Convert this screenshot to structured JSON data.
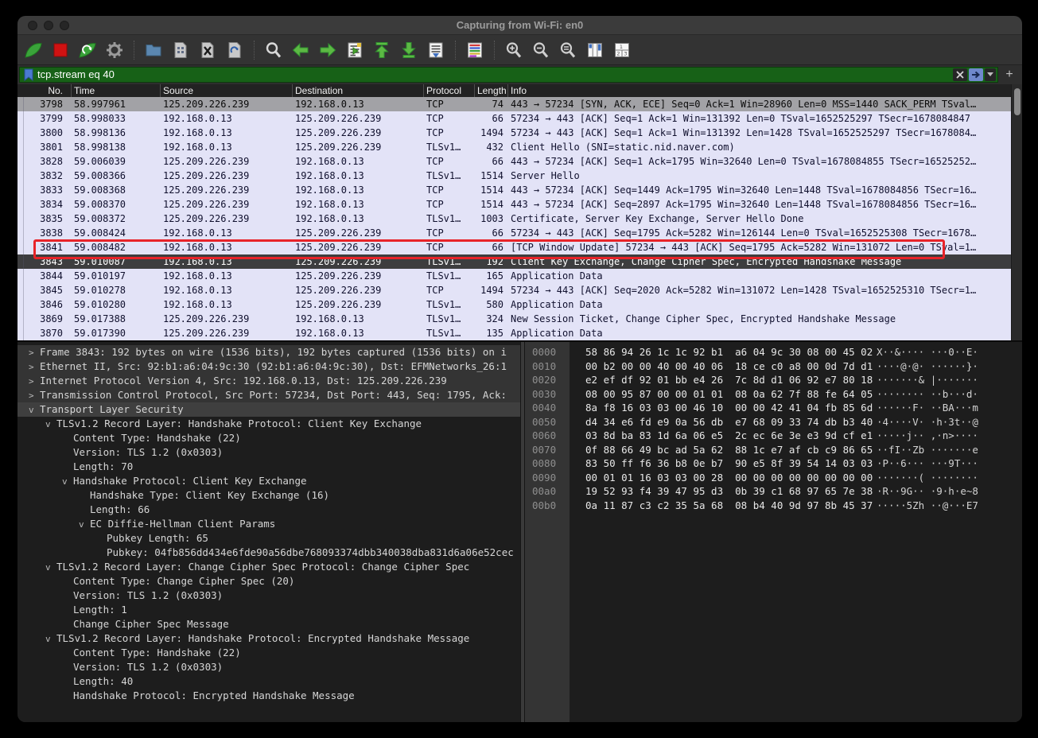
{
  "window": {
    "title": "Capturing from Wi-Fi: en0"
  },
  "colors": {
    "filter_bar_green": "#176117",
    "annotation_red": "#e82329",
    "row_lavender": "#e3e3f7",
    "selected_row": "#3d3d3f",
    "gray_row": "#a2a2a6"
  },
  "toolbar": {
    "items": [
      {
        "name": "start-capture",
        "icon": "wireshark-fin"
      },
      {
        "name": "stop-capture",
        "icon": "stop"
      },
      {
        "name": "restart-capture",
        "icon": "restart-fin"
      },
      {
        "name": "capture-options",
        "icon": "gear"
      },
      {
        "sep": true
      },
      {
        "name": "open-file",
        "icon": "folder"
      },
      {
        "name": "save-file",
        "icon": "save-doc"
      },
      {
        "name": "close-file",
        "icon": "close-doc"
      },
      {
        "name": "reload-file",
        "icon": "reload-doc"
      },
      {
        "sep": true
      },
      {
        "name": "find-packet",
        "icon": "magnifier"
      },
      {
        "name": "go-back",
        "icon": "arrow-left"
      },
      {
        "name": "go-forward",
        "icon": "arrow-right"
      },
      {
        "name": "go-to-packet",
        "icon": "goto-doc"
      },
      {
        "name": "go-first-packet",
        "icon": "arrow-top"
      },
      {
        "name": "go-last-packet",
        "icon": "arrow-bottom"
      },
      {
        "name": "auto-scroll",
        "icon": "autoscroll-doc"
      },
      {
        "sep": true
      },
      {
        "name": "colorize-packets",
        "icon": "colorize"
      },
      {
        "sep": true
      },
      {
        "name": "zoom-in",
        "icon": "magnifier-plus"
      },
      {
        "name": "zoom-out",
        "icon": "magnifier-minus"
      },
      {
        "name": "zoom-reset",
        "icon": "magnifier-equal"
      },
      {
        "name": "resize-columns",
        "icon": "columns"
      },
      {
        "name": "layout-chooser",
        "icon": "layout-123"
      }
    ]
  },
  "filter": {
    "value": "tcp.stream eq 40",
    "add_button_label": "+"
  },
  "packet_list": {
    "columns": [
      {
        "id": "no",
        "label": "No."
      },
      {
        "id": "time",
        "label": "Time"
      },
      {
        "id": "source",
        "label": "Source"
      },
      {
        "id": "destination",
        "label": "Destination"
      },
      {
        "id": "protocol",
        "label": "Protocol"
      },
      {
        "id": "length",
        "label": "Length"
      },
      {
        "id": "info",
        "label": "Info"
      }
    ],
    "rows": [
      {
        "no": "3798",
        "time": "58.997961",
        "source": "125.209.226.239",
        "destination": "192.168.0.13",
        "protocol": "TCP",
        "length": "74",
        "info": "443 → 57234 [SYN, ACK, ECE] Seq=0 Ack=1 Win=28960 Len=0 MSS=1440 SACK_PERM TSval…",
        "state": "gray"
      },
      {
        "no": "3799",
        "time": "58.998033",
        "source": "192.168.0.13",
        "destination": "125.209.226.239",
        "protocol": "TCP",
        "length": "66",
        "info": "57234 → 443 [ACK] Seq=1 Ack=1 Win=131392 Len=0 TSval=1652525297 TSecr=1678084847",
        "state": ""
      },
      {
        "no": "3800",
        "time": "58.998136",
        "source": "192.168.0.13",
        "destination": "125.209.226.239",
        "protocol": "TCP",
        "length": "1494",
        "info": "57234 → 443 [ACK] Seq=1 Ack=1 Win=131392 Len=1428 TSval=1652525297 TSecr=1678084…",
        "state": ""
      },
      {
        "no": "3801",
        "time": "58.998138",
        "source": "192.168.0.13",
        "destination": "125.209.226.239",
        "protocol": "TLSv1…",
        "length": "432",
        "info": "Client Hello (SNI=static.nid.naver.com)",
        "state": ""
      },
      {
        "no": "3828",
        "time": "59.006039",
        "source": "125.209.226.239",
        "destination": "192.168.0.13",
        "protocol": "TCP",
        "length": "66",
        "info": "443 → 57234 [ACK] Seq=1 Ack=1795 Win=32640 Len=0 TSval=1678084855 TSecr=16525252…",
        "state": ""
      },
      {
        "no": "3832",
        "time": "59.008366",
        "source": "125.209.226.239",
        "destination": "192.168.0.13",
        "protocol": "TLSv1…",
        "length": "1514",
        "info": "Server Hello",
        "state": ""
      },
      {
        "no": "3833",
        "time": "59.008368",
        "source": "125.209.226.239",
        "destination": "192.168.0.13",
        "protocol": "TCP",
        "length": "1514",
        "info": "443 → 57234 [ACK] Seq=1449 Ack=1795 Win=32640 Len=1448 TSval=1678084856 TSecr=16…",
        "state": ""
      },
      {
        "no": "3834",
        "time": "59.008370",
        "source": "125.209.226.239",
        "destination": "192.168.0.13",
        "protocol": "TCP",
        "length": "1514",
        "info": "443 → 57234 [ACK] Seq=2897 Ack=1795 Win=32640 Len=1448 TSval=1678084856 TSecr=16…",
        "state": ""
      },
      {
        "no": "3835",
        "time": "59.008372",
        "source": "125.209.226.239",
        "destination": "192.168.0.13",
        "protocol": "TLSv1…",
        "length": "1003",
        "info": "Certificate, Server Key Exchange, Server Hello Done",
        "state": ""
      },
      {
        "no": "3838",
        "time": "59.008424",
        "source": "192.168.0.13",
        "destination": "125.209.226.239",
        "protocol": "TCP",
        "length": "66",
        "info": "57234 → 443 [ACK] Seq=1795 Ack=5282 Win=126144 Len=0 TSval=1652525308 TSecr=1678…",
        "state": ""
      },
      {
        "no": "3841",
        "time": "59.008482",
        "source": "192.168.0.13",
        "destination": "125.209.226.239",
        "protocol": "TCP",
        "length": "66",
        "info": "[TCP Window Update] 57234 → 443 [ACK] Seq=1795 Ack=5282 Win=131072 Len=0 TSval=1…",
        "state": ""
      },
      {
        "no": "3843",
        "time": "59.010087",
        "source": "192.168.0.13",
        "destination": "125.209.226.239",
        "protocol": "TLSv1…",
        "length": "192",
        "info": "Client Key Exchange, Change Cipher Spec, Encrypted Handshake Message",
        "state": "selected"
      },
      {
        "no": "3844",
        "time": "59.010197",
        "source": "192.168.0.13",
        "destination": "125.209.226.239",
        "protocol": "TLSv1…",
        "length": "165",
        "info": "Application Data",
        "state": ""
      },
      {
        "no": "3845",
        "time": "59.010278",
        "source": "192.168.0.13",
        "destination": "125.209.226.239",
        "protocol": "TCP",
        "length": "1494",
        "info": "57234 → 443 [ACK] Seq=2020 Ack=5282 Win=131072 Len=1428 TSval=1652525310 TSecr=1…",
        "state": ""
      },
      {
        "no": "3846",
        "time": "59.010280",
        "source": "192.168.0.13",
        "destination": "125.209.226.239",
        "protocol": "TLSv1…",
        "length": "580",
        "info": "Application Data",
        "state": ""
      },
      {
        "no": "3869",
        "time": "59.017388",
        "source": "125.209.226.239",
        "destination": "192.168.0.13",
        "protocol": "TLSv1…",
        "length": "324",
        "info": "New Session Ticket, Change Cipher Spec, Encrypted Handshake Message",
        "state": ""
      },
      {
        "no": "3870",
        "time": "59.017390",
        "source": "125.209.226.239",
        "destination": "192.168.0.13",
        "protocol": "TLSv1…",
        "length": "135",
        "info": "Application Data",
        "state": ""
      }
    ]
  },
  "details": {
    "lines": [
      {
        "level": 0,
        "arrow": ">",
        "text": "Frame 3843: 192 bytes on wire (1536 bits), 192 bytes captured (1536 bits) on i",
        "block": true
      },
      {
        "level": 0,
        "arrow": ">",
        "text": "Ethernet II, Src: 92:b1:a6:04:9c:30 (92:b1:a6:04:9c:30), Dst: EFMNetworks_26:1",
        "block": true
      },
      {
        "level": 0,
        "arrow": ">",
        "text": "Internet Protocol Version 4, Src: 192.168.0.13, Dst: 125.209.226.239",
        "block": true
      },
      {
        "level": 0,
        "arrow": ">",
        "text": "Transmission Control Protocol, Src Port: 57234, Dst Port: 443, Seq: 1795, Ack:",
        "block": true
      },
      {
        "level": 0,
        "arrow": "v",
        "text": "Transport Layer Security",
        "block": true,
        "selected": true
      },
      {
        "level": 1,
        "arrow": "v",
        "text": "TLSv1.2 Record Layer: Handshake Protocol: Client Key Exchange"
      },
      {
        "level": 2,
        "arrow": "",
        "text": "Content Type: Handshake (22)"
      },
      {
        "level": 2,
        "arrow": "",
        "text": "Version: TLS 1.2 (0x0303)"
      },
      {
        "level": 2,
        "arrow": "",
        "text": "Length: 70"
      },
      {
        "level": 2,
        "arrow": "v",
        "text": "Handshake Protocol: Client Key Exchange"
      },
      {
        "level": 3,
        "arrow": "",
        "text": "Handshake Type: Client Key Exchange (16)"
      },
      {
        "level": 3,
        "arrow": "",
        "text": "Length: 66"
      },
      {
        "level": 3,
        "arrow": "v",
        "text": "EC Diffie-Hellman Client Params"
      },
      {
        "level": 4,
        "arrow": "",
        "text": "Pubkey Length: 65"
      },
      {
        "level": 4,
        "arrow": "",
        "text": "Pubkey: 04fb856dd434e6fde90a56dbe768093374dbb340038dba831d6a06e52cec"
      },
      {
        "level": 1,
        "arrow": "v",
        "text": "TLSv1.2 Record Layer: Change Cipher Spec Protocol: Change Cipher Spec"
      },
      {
        "level": 2,
        "arrow": "",
        "text": "Content Type: Change Cipher Spec (20)"
      },
      {
        "level": 2,
        "arrow": "",
        "text": "Version: TLS 1.2 (0x0303)"
      },
      {
        "level": 2,
        "arrow": "",
        "text": "Length: 1"
      },
      {
        "level": 2,
        "arrow": "",
        "text": "Change Cipher Spec Message"
      },
      {
        "level": 1,
        "arrow": "v",
        "text": "TLSv1.2 Record Layer: Handshake Protocol: Encrypted Handshake Message"
      },
      {
        "level": 2,
        "arrow": "",
        "text": "Content Type: Handshake (22)"
      },
      {
        "level": 2,
        "arrow": "",
        "text": "Version: TLS 1.2 (0x0303)"
      },
      {
        "level": 2,
        "arrow": "",
        "text": "Length: 40"
      },
      {
        "level": 2,
        "arrow": "",
        "text": "Handshake Protocol: Encrypted Handshake Message"
      }
    ]
  },
  "hex": {
    "rows": [
      {
        "offset": "0000",
        "bytes": "58 86 94 26 1c 1c 92 b1  a6 04 9c 30 08 00 45 02",
        "ascii": "X··&···· ···0··E·"
      },
      {
        "offset": "0010",
        "bytes": "00 b2 00 00 40 00 40 06  18 ce c0 a8 00 0d 7d d1",
        "ascii": "····@·@· ······}·"
      },
      {
        "offset": "0020",
        "bytes": "e2 ef df 92 01 bb e4 26  7c 8d d1 06 92 e7 80 18",
        "ascii": "·······& |·······"
      },
      {
        "offset": "0030",
        "bytes": "08 00 95 87 00 00 01 01  08 0a 62 7f 88 fe 64 05",
        "ascii": "········ ··b···d·"
      },
      {
        "offset": "0040",
        "bytes": "8a f8 16 03 03 00 46 10  00 00 42 41 04 fb 85 6d",
        "ascii": "······F· ··BA···m"
      },
      {
        "offset": "0050",
        "bytes": "d4 34 e6 fd e9 0a 56 db  e7 68 09 33 74 db b3 40",
        "ascii": "·4····V· ·h·3t··@"
      },
      {
        "offset": "0060",
        "bytes": "03 8d ba 83 1d 6a 06 e5  2c ec 6e 3e e3 9d cf e1",
        "ascii": "·····j·· ,·n>····"
      },
      {
        "offset": "0070",
        "bytes": "0f 88 66 49 bc ad 5a 62  88 1c e7 af cb c9 86 65",
        "ascii": "··fI··Zb ·······e"
      },
      {
        "offset": "0080",
        "bytes": "83 50 ff f6 36 b8 0e b7  90 e5 8f 39 54 14 03 03",
        "ascii": "·P··6··· ···9T···"
      },
      {
        "offset": "0090",
        "bytes": "00 01 01 16 03 03 00 28  00 00 00 00 00 00 00 00",
        "ascii": "·······( ········"
      },
      {
        "offset": "00a0",
        "bytes": "19 52 93 f4 39 47 95 d3  0b 39 c1 68 97 65 7e 38",
        "ascii": "·R··9G·· ·9·h·e~8"
      },
      {
        "offset": "00b0",
        "bytes": "0a 11 87 c3 c2 35 5a 68  08 b4 40 9d 97 8b 45 37",
        "ascii": "·····5Zh ··@···E7"
      }
    ]
  }
}
